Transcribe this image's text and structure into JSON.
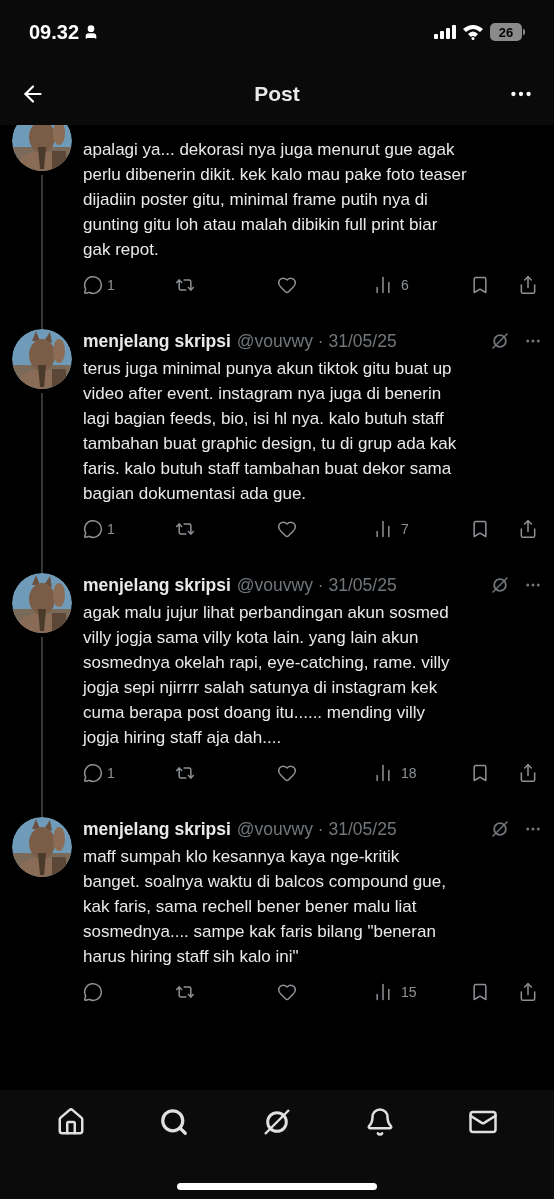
{
  "status_bar": {
    "time": "09.32",
    "battery": "26"
  },
  "nav": {
    "title": "Post"
  },
  "posts": [
    {
      "text": "apalagi ya... dekorasi nya juga menurut gue agak\nperlu dibenerin dikit. kek kalo mau pake foto teaser\ndijadiin poster gitu, minimal frame putih nya di\ngunting gitu loh atau malah dibikin full print biar\ngak repot.",
      "replies": "1",
      "views": "6"
    },
    {
      "author": "menjelang skripsi",
      "meta": "@vouvwy · 31/05/25",
      "text": "terus juga minimal punya akun tiktok gitu buat up\nvideo after event. instagram nya juga di benerin\nlagi bagian feeds, bio, isi hl nya. kalo butuh staff\ntambahan buat graphic design, tu di grup ada kak\nfaris. kalo butuh staff tambahan buat dekor sama\nbagian dokumentasi ada gue.",
      "replies": "1",
      "views": "7"
    },
    {
      "author": "menjelang skripsi",
      "meta": "@vouvwy · 31/05/25",
      "text": "agak malu jujur lihat perbandingan akun sosmed\nvilly jogja sama villy kota lain. yang lain akun\nsosmednya okelah rapi, eye-catching, rame. villy\njogja sepi njirrrr salah satunya di instagram kek\ncuma berapa post doang itu...... mending villy\njogja hiring staff aja dah....",
      "replies": "1",
      "views": "18"
    },
    {
      "author": "menjelang skripsi",
      "meta": "@vouvwy · 31/05/25",
      "text": "maff sumpah klo kesannya kaya nge-kritik\nbanget. soalnya waktu di balcos compound gue,\nkak faris, sama rechell bener bener malu liat\nsosmednya.... sampe kak faris bilang \"beneran\nharus hiring staff sih kalo ini\"",
      "views": "15"
    }
  ]
}
